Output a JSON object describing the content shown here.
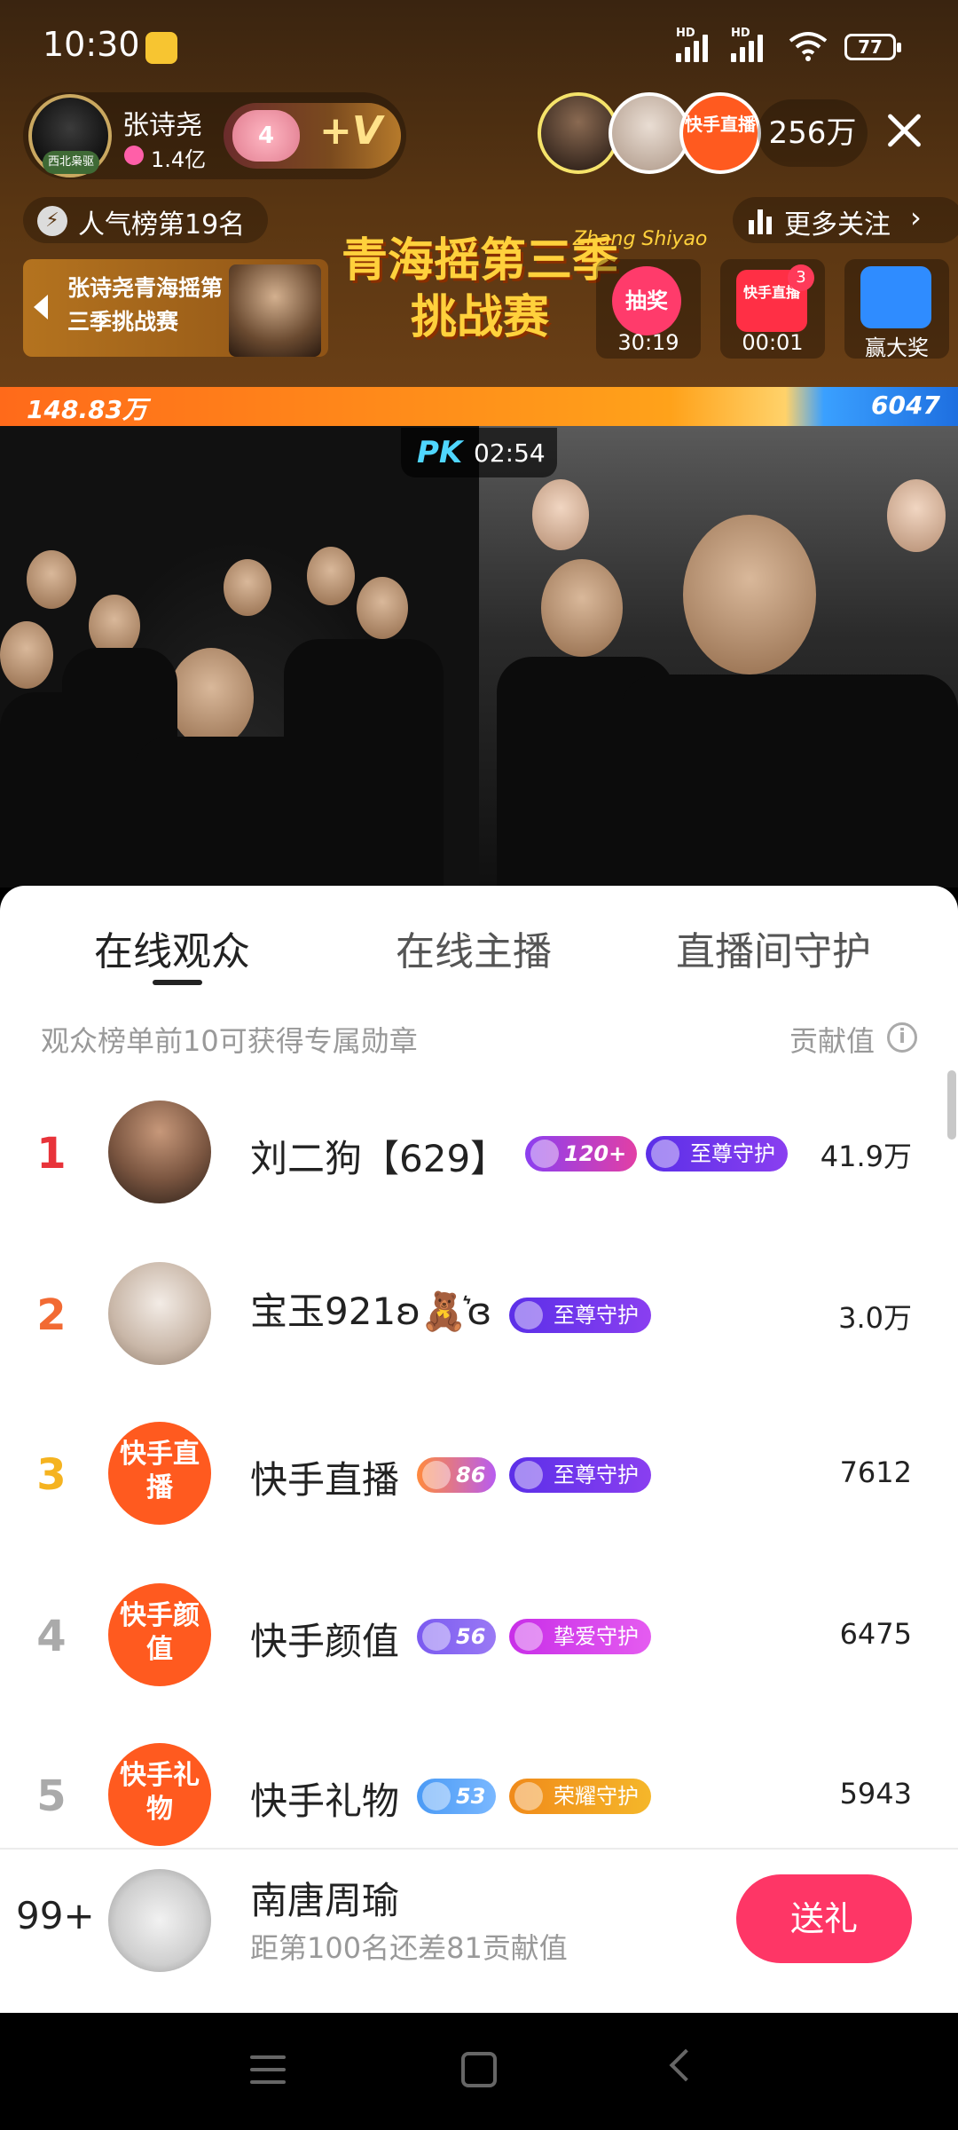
{
  "status_bar": {
    "time": "10:30",
    "hd1": "HD",
    "hd2": "HD",
    "battery": "77"
  },
  "host": {
    "badge": "西北枭驱",
    "name": "张诗尧",
    "fans": "1.4亿",
    "level": "4",
    "plus_v": "+V"
  },
  "audience_bar": {
    "top_viewer_3": "快手直播",
    "count": "256万"
  },
  "rank_pill": {
    "icon": "⚡",
    "text": "人气榜第19名"
  },
  "follow": {
    "text": "更多关注",
    "arrow": "›"
  },
  "banner": {
    "left_text": "张诗尧青海摇第三季挑战赛",
    "title": "青海摇第三季挑战赛",
    "signature": "Zhang Shiyao"
  },
  "activities": [
    {
      "icon_text": "抽奖",
      "time": "30:19",
      "color": "#ff3b6b"
    },
    {
      "icon_text": "快手直播",
      "time": "00:01",
      "badge": "3",
      "color": "#ff2f45"
    },
    {
      "icon_text": "",
      "time": "赢大奖",
      "color": "#2f8cff"
    }
  ],
  "pk": {
    "left_score": "148.83万",
    "right_score": "6047",
    "logo": "PK",
    "timer": "02:54",
    "left_share": 0.82
  },
  "tabs": [
    {
      "label": "在线观众",
      "active": true
    },
    {
      "label": "在线主播",
      "active": false
    },
    {
      "label": "直播间守护",
      "active": false
    }
  ],
  "list_header": {
    "hint": "观众榜单前10可获得专属勋章",
    "contrib_label": "贡献值",
    "info_icon": "i"
  },
  "viewers": [
    {
      "rank": "1",
      "name": "刘二狗【629】",
      "level": "120+",
      "guard": "至尊守护",
      "value": "41.9万",
      "rank_color": "#e8333a",
      "avatar": "photo"
    },
    {
      "rank": "2",
      "name": "宝玉921ʚ🧸͛ɞ",
      "level": "",
      "guard": "至尊守护",
      "value": "3.0万",
      "rank_color": "#f26a33",
      "avatar": "photo"
    },
    {
      "rank": "3",
      "name": "快手直播",
      "level": "86",
      "guard": "至尊守护",
      "value": "7612",
      "rank_color": "#f5b320",
      "avatar": "brand",
      "avatar_text": "快手直播"
    },
    {
      "rank": "4",
      "name": "快手颜值",
      "level": "56",
      "guard": "挚爱守护",
      "value": "6475",
      "rank_color": "#aaaaaa",
      "avatar": "brand",
      "avatar_text": "快手颜值"
    },
    {
      "rank": "5",
      "name": "快手礼物",
      "level": "53",
      "guard": "荣耀守护",
      "value": "5943",
      "rank_color": "#aaaaaa",
      "avatar": "brand",
      "avatar_text": "快手礼物"
    }
  ],
  "me": {
    "rank": "99+",
    "name": "南唐周瑜",
    "sub": "距第100名还差81贡献值",
    "gift_button": "送礼"
  },
  "colors": {
    "accent": "#fe3666",
    "brand_orange": "#ff5a1f",
    "guard_purple": "#6a3cf0",
    "guard_pink": "#d53cf0",
    "guard_gold": "#f2a51a"
  }
}
